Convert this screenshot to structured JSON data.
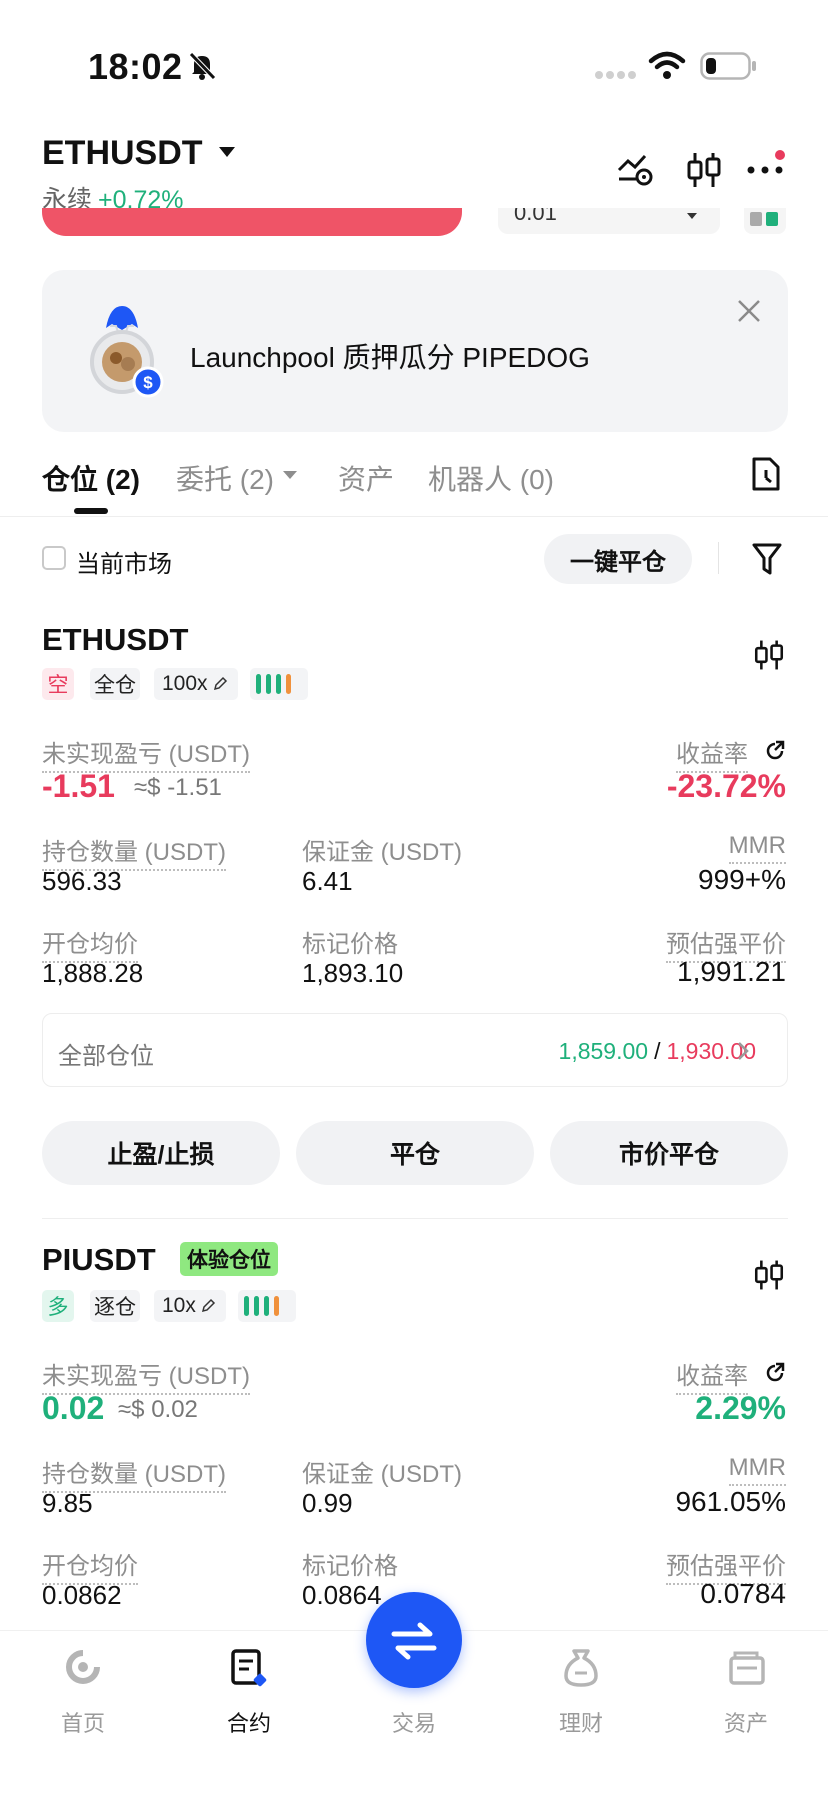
{
  "status_bar": {
    "time": "18:02"
  },
  "header": {
    "pair": "ETHUSDT",
    "type": "永续",
    "change": "+0.72%",
    "partial_value": "0.01"
  },
  "promo": {
    "text": "Launchpool 质押瓜分 PIPEDOG"
  },
  "tabs": [
    {
      "label": "仓位 (2)",
      "active": true
    },
    {
      "label": "委托 (2)",
      "active": false
    },
    {
      "label": "资产",
      "active": false
    },
    {
      "label": "机器人 (0)",
      "active": false
    }
  ],
  "filter": {
    "current_market": "当前市场",
    "close_all": "一键平仓"
  },
  "positions": [
    {
      "symbol": "ETHUSDT",
      "side": "空",
      "margin_mode": "全仓",
      "leverage": "100x",
      "pnl_label": "未实现盈亏 (USDT)",
      "pnl": "-1.51",
      "pnl_usd": "≈$ -1.51",
      "roe_label": "收益率",
      "roe": "-23.72%",
      "size_label": "持仓数量 (USDT)",
      "size": "596.33",
      "margin_label": "保证金 (USDT)",
      "margin": "6.41",
      "mmr_label": "MMR",
      "mmr": "999+%",
      "entry_label": "开仓均价",
      "entry": "1,888.28",
      "mark_label": "标记价格",
      "mark": "1,893.10",
      "liq_label": "预估强平价",
      "liq": "1,991.21"
    },
    {
      "symbol": "PIUSDT",
      "badge": "体验仓位",
      "side": "多",
      "margin_mode": "逐仓",
      "leverage": "10x",
      "pnl_label": "未实现盈亏 (USDT)",
      "pnl": "0.02",
      "pnl_usd": "≈$ 0.02",
      "roe_label": "收益率",
      "roe": "2.29%",
      "size_label": "持仓数量 (USDT)",
      "size": "9.85",
      "margin_label": "保证金 (USDT)",
      "margin": "0.99",
      "mmr_label": "MMR",
      "mmr": "961.05%",
      "entry_label": "开仓均价",
      "entry": "0.0862",
      "mark_label": "标记价格",
      "mark": "0.0864",
      "liq_label": "预估强平价",
      "liq": "0.0784"
    }
  ],
  "all_positions": {
    "label": "全部仓位",
    "tp": "1,859.00",
    "sep": "/",
    "sl": "1,930.00"
  },
  "actions": {
    "tpsl": "止盈/止损",
    "close": "平仓",
    "market_close": "市价平仓"
  },
  "bottom_nav": [
    {
      "label": "首页",
      "icon": "home-icon"
    },
    {
      "label": "合约",
      "icon": "futures-icon"
    },
    {
      "label": "交易",
      "icon": "swap-icon"
    },
    {
      "label": "理财",
      "icon": "earn-icon"
    },
    {
      "label": "资产",
      "icon": "wallet-icon"
    }
  ],
  "colors": {
    "green": "#1fb07b",
    "red": "#e83b5d",
    "orange": "#f0913c",
    "blue": "#1e57f5",
    "trial_badge": "#8fe880"
  }
}
